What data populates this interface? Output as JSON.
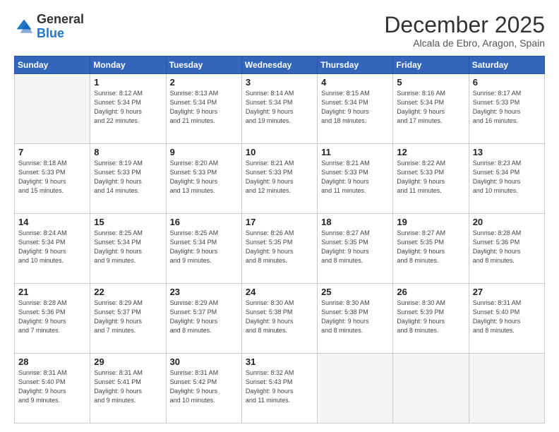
{
  "logo": {
    "general": "General",
    "blue": "Blue"
  },
  "header": {
    "month": "December 2025",
    "location": "Alcala de Ebro, Aragon, Spain"
  },
  "days_of_week": [
    "Sunday",
    "Monday",
    "Tuesday",
    "Wednesday",
    "Thursday",
    "Friday",
    "Saturday"
  ],
  "weeks": [
    [
      {
        "day": "",
        "info": ""
      },
      {
        "day": "1",
        "info": "Sunrise: 8:12 AM\nSunset: 5:34 PM\nDaylight: 9 hours\nand 22 minutes."
      },
      {
        "day": "2",
        "info": "Sunrise: 8:13 AM\nSunset: 5:34 PM\nDaylight: 9 hours\nand 21 minutes."
      },
      {
        "day": "3",
        "info": "Sunrise: 8:14 AM\nSunset: 5:34 PM\nDaylight: 9 hours\nand 19 minutes."
      },
      {
        "day": "4",
        "info": "Sunrise: 8:15 AM\nSunset: 5:34 PM\nDaylight: 9 hours\nand 18 minutes."
      },
      {
        "day": "5",
        "info": "Sunrise: 8:16 AM\nSunset: 5:34 PM\nDaylight: 9 hours\nand 17 minutes."
      },
      {
        "day": "6",
        "info": "Sunrise: 8:17 AM\nSunset: 5:33 PM\nDaylight: 9 hours\nand 16 minutes."
      }
    ],
    [
      {
        "day": "7",
        "info": "Sunrise: 8:18 AM\nSunset: 5:33 PM\nDaylight: 9 hours\nand 15 minutes."
      },
      {
        "day": "8",
        "info": "Sunrise: 8:19 AM\nSunset: 5:33 PM\nDaylight: 9 hours\nand 14 minutes."
      },
      {
        "day": "9",
        "info": "Sunrise: 8:20 AM\nSunset: 5:33 PM\nDaylight: 9 hours\nand 13 minutes."
      },
      {
        "day": "10",
        "info": "Sunrise: 8:21 AM\nSunset: 5:33 PM\nDaylight: 9 hours\nand 12 minutes."
      },
      {
        "day": "11",
        "info": "Sunrise: 8:21 AM\nSunset: 5:33 PM\nDaylight: 9 hours\nand 11 minutes."
      },
      {
        "day": "12",
        "info": "Sunrise: 8:22 AM\nSunset: 5:33 PM\nDaylight: 9 hours\nand 11 minutes."
      },
      {
        "day": "13",
        "info": "Sunrise: 8:23 AM\nSunset: 5:34 PM\nDaylight: 9 hours\nand 10 minutes."
      }
    ],
    [
      {
        "day": "14",
        "info": "Sunrise: 8:24 AM\nSunset: 5:34 PM\nDaylight: 9 hours\nand 10 minutes."
      },
      {
        "day": "15",
        "info": "Sunrise: 8:25 AM\nSunset: 5:34 PM\nDaylight: 9 hours\nand 9 minutes."
      },
      {
        "day": "16",
        "info": "Sunrise: 8:25 AM\nSunset: 5:34 PM\nDaylight: 9 hours\nand 9 minutes."
      },
      {
        "day": "17",
        "info": "Sunrise: 8:26 AM\nSunset: 5:35 PM\nDaylight: 9 hours\nand 8 minutes."
      },
      {
        "day": "18",
        "info": "Sunrise: 8:27 AM\nSunset: 5:35 PM\nDaylight: 9 hours\nand 8 minutes."
      },
      {
        "day": "19",
        "info": "Sunrise: 8:27 AM\nSunset: 5:35 PM\nDaylight: 9 hours\nand 8 minutes."
      },
      {
        "day": "20",
        "info": "Sunrise: 8:28 AM\nSunset: 5:36 PM\nDaylight: 9 hours\nand 8 minutes."
      }
    ],
    [
      {
        "day": "21",
        "info": "Sunrise: 8:28 AM\nSunset: 5:36 PM\nDaylight: 9 hours\nand 7 minutes."
      },
      {
        "day": "22",
        "info": "Sunrise: 8:29 AM\nSunset: 5:37 PM\nDaylight: 9 hours\nand 7 minutes."
      },
      {
        "day": "23",
        "info": "Sunrise: 8:29 AM\nSunset: 5:37 PM\nDaylight: 9 hours\nand 8 minutes."
      },
      {
        "day": "24",
        "info": "Sunrise: 8:30 AM\nSunset: 5:38 PM\nDaylight: 9 hours\nand 8 minutes."
      },
      {
        "day": "25",
        "info": "Sunrise: 8:30 AM\nSunset: 5:38 PM\nDaylight: 9 hours\nand 8 minutes."
      },
      {
        "day": "26",
        "info": "Sunrise: 8:30 AM\nSunset: 5:39 PM\nDaylight: 9 hours\nand 8 minutes."
      },
      {
        "day": "27",
        "info": "Sunrise: 8:31 AM\nSunset: 5:40 PM\nDaylight: 9 hours\nand 8 minutes."
      }
    ],
    [
      {
        "day": "28",
        "info": "Sunrise: 8:31 AM\nSunset: 5:40 PM\nDaylight: 9 hours\nand 9 minutes."
      },
      {
        "day": "29",
        "info": "Sunrise: 8:31 AM\nSunset: 5:41 PM\nDaylight: 9 hours\nand 9 minutes."
      },
      {
        "day": "30",
        "info": "Sunrise: 8:31 AM\nSunset: 5:42 PM\nDaylight: 9 hours\nand 10 minutes."
      },
      {
        "day": "31",
        "info": "Sunrise: 8:32 AM\nSunset: 5:43 PM\nDaylight: 9 hours\nand 11 minutes."
      },
      {
        "day": "",
        "info": ""
      },
      {
        "day": "",
        "info": ""
      },
      {
        "day": "",
        "info": ""
      }
    ]
  ]
}
